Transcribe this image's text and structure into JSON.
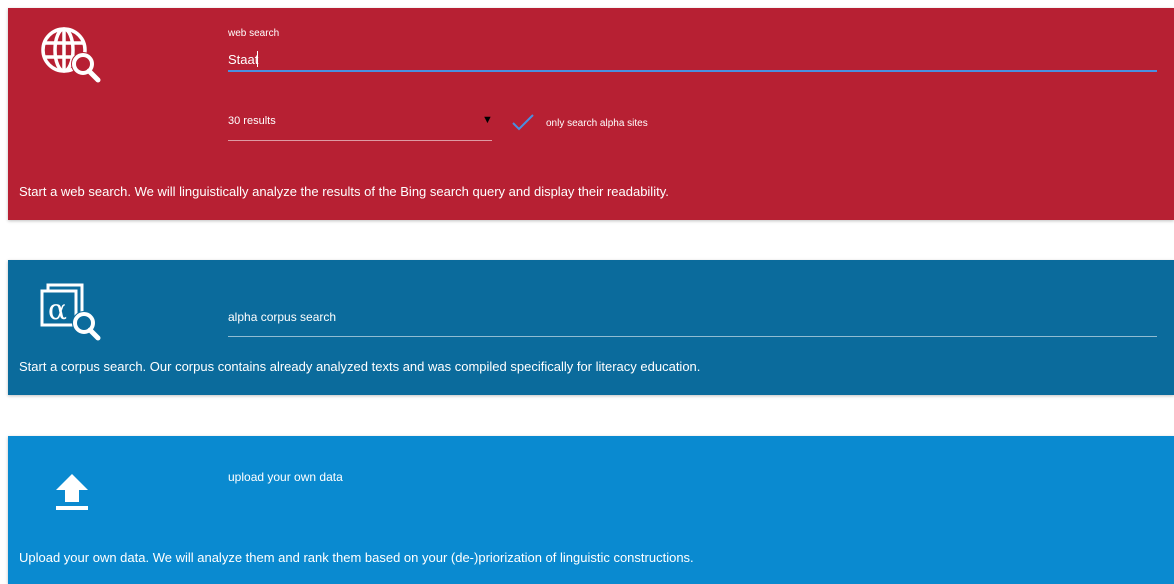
{
  "web_search": {
    "label": "web search",
    "query_value": "Staat",
    "results_select": {
      "selected": "30 results",
      "arrow_glyph": "▼"
    },
    "alpha_checkbox": {
      "checked": true,
      "label": "only search alpha sites"
    },
    "description": "Start a web search. We will linguistically analyze the results of the Bing search query and display their readability.",
    "icon": "globe-search-icon",
    "background_color": "#b72033",
    "input_underline_color": "#4a8fe0"
  },
  "corpus_search": {
    "field_label": "alpha corpus search",
    "description": "Start a corpus search. Our corpus contains already analyzed texts and was compiled specifically for literacy education.",
    "icon": "alpha-corpus-search-icon",
    "background_color": "#0b6b9c"
  },
  "upload": {
    "button_label": "upload your own data",
    "description": "Upload your own data. We will analyze them and rank them based on your (de-)priorization of linguistic constructions.",
    "icon": "upload-icon",
    "background_color": "#0a8ad0"
  }
}
